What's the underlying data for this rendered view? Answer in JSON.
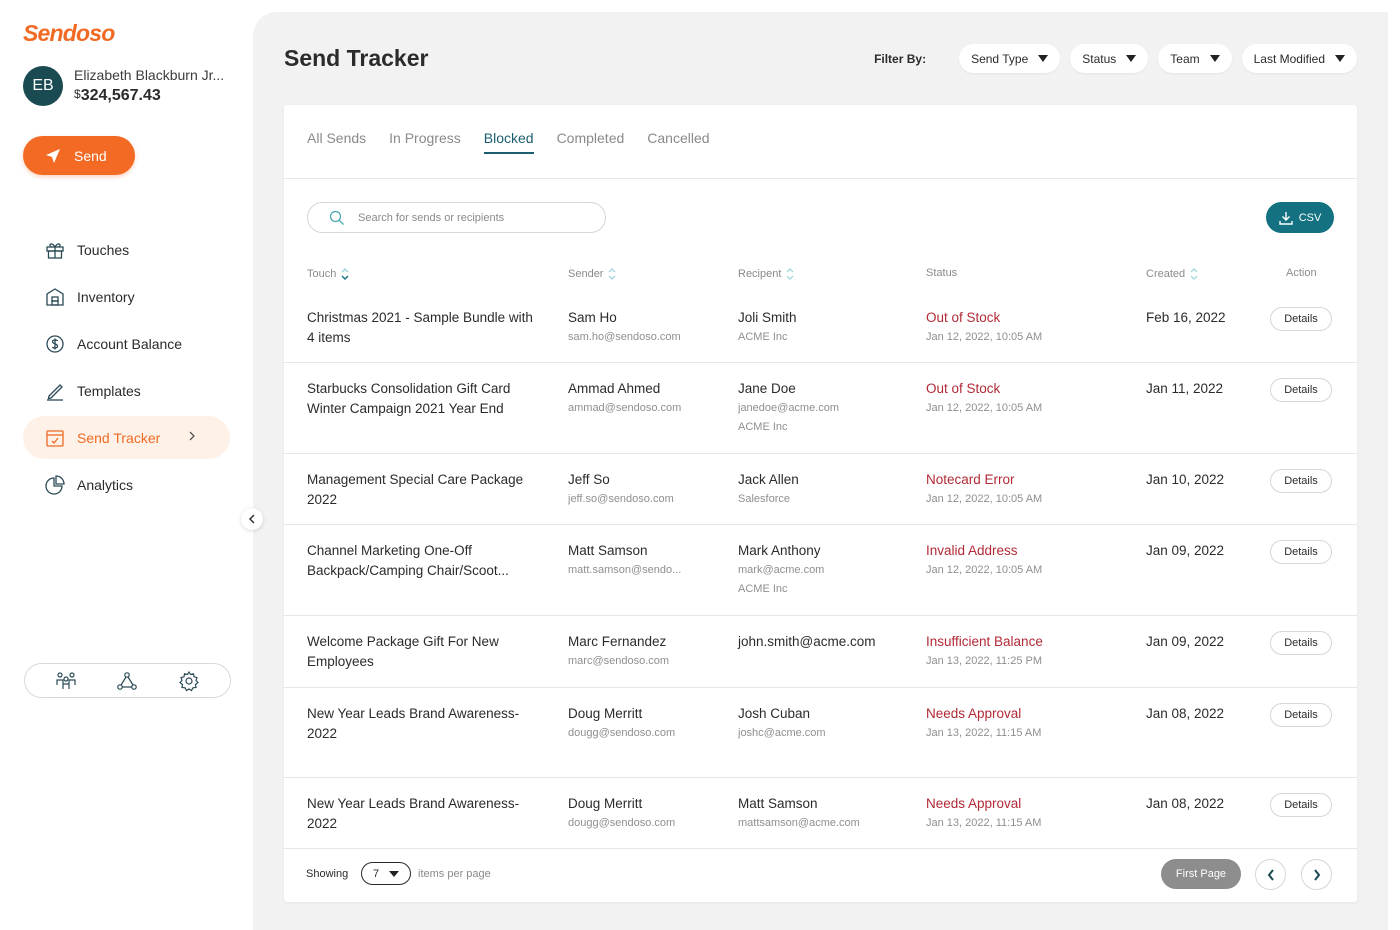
{
  "brand": {
    "logo": "Sendoso",
    "accent": "#f26a23",
    "teal": "#137181",
    "error": "#b12a36"
  },
  "user": {
    "initials": "EB",
    "name": "Elizabeth Blackburn Jr...",
    "currency": "$",
    "balance": "324,567.43"
  },
  "sidebar": {
    "send_label": "Send",
    "items": [
      {
        "label": "Touches",
        "icon": "gift-icon"
      },
      {
        "label": "Inventory",
        "icon": "warehouse-icon"
      },
      {
        "label": "Account Balance",
        "icon": "dollar-icon"
      },
      {
        "label": "Templates",
        "icon": "pen-icon"
      },
      {
        "label": "Send Tracker",
        "icon": "tracker-icon",
        "active": true
      },
      {
        "label": "Analytics",
        "icon": "pie-chart-icon"
      }
    ],
    "bottom_icons": [
      "people-icon",
      "network-icon",
      "gear-icon"
    ]
  },
  "header": {
    "title": "Send Tracker",
    "filter_label": "Filter By:",
    "filters": [
      "Send Type",
      "Status",
      "Team",
      "Last Modified"
    ]
  },
  "tabs": [
    "All Sends",
    "In Progress",
    "Blocked",
    "Completed",
    "Cancelled"
  ],
  "active_tab": "Blocked",
  "search": {
    "placeholder": "Search for sends or recipients"
  },
  "csv_label": "CSV",
  "columns": {
    "touch": "Touch",
    "sender": "Sender",
    "recipient": "Recipent",
    "status": "Status",
    "created": "Created",
    "action": "Action"
  },
  "rows": [
    {
      "touch": "Christmas 2021 - Sample Bundle with 4 items",
      "sender": "Sam Ho",
      "sender_email": "sam.ho@sendoso.com",
      "recipient": "Joli Smith",
      "recipient_lines": [
        "ACME Inc"
      ],
      "status": "Out of Stock",
      "status_time": "Jan 12, 2022, 10:05 AM",
      "created": "Feb 16, 2022",
      "action": "Details"
    },
    {
      "touch": "Starbucks Consolidation Gift Card Winter Campaign 2021 Year End",
      "sender": "Ammad Ahmed",
      "sender_email": "ammad@sendoso.com",
      "recipient": "Jane Doe",
      "recipient_lines": [
        "janedoe@acme.com",
        "ACME Inc"
      ],
      "status": "Out of Stock",
      "status_time": "Jan 12, 2022, 10:05 AM",
      "created": "Jan 11, 2022",
      "action": "Details"
    },
    {
      "touch": "Management Special Care Package 2022",
      "sender": "Jeff So",
      "sender_email": "jeff.so@sendoso.com",
      "recipient": "Jack Allen",
      "recipient_lines": [
        "Salesforce"
      ],
      "status": "Notecard Error",
      "status_time": "Jan 12, 2022, 10:05 AM",
      "created": "Jan 10, 2022",
      "action": "Details"
    },
    {
      "touch": "Channel Marketing One-Off Backpack/Camping Chair/Scoot...",
      "sender": "Matt Samson",
      "sender_email": "matt.samson@sendo...",
      "recipient": "Mark Anthony",
      "recipient_lines": [
        "mark@acme.com",
        "ACME Inc"
      ],
      "status": "Invalid Address",
      "status_time": "Jan 12, 2022, 10:05 AM",
      "created": "Jan 09, 2022",
      "action": "Details"
    },
    {
      "touch": "Welcome Package Gift For New Employees",
      "sender": "Marc Fernandez",
      "sender_email": "marc@sendoso.com",
      "recipient": "john.smith@acme.com",
      "recipient_lines": [],
      "status": "Insufficient Balance",
      "status_time": "Jan 13, 2022, 11:25 PM",
      "created": "Jan 09, 2022",
      "action": "Details"
    },
    {
      "touch": "New Year Leads Brand Awareness-2022",
      "sender": "Doug Merritt",
      "sender_email": "dougg@sendoso.com",
      "recipient": "Josh Cuban",
      "recipient_lines": [
        "joshc@acme.com"
      ],
      "status": "Needs Approval",
      "status_time": "Jan 13, 2022, 11:15 AM",
      "created": "Jan 08, 2022",
      "action": "Details"
    },
    {
      "touch": "New Year Leads Brand Awareness-2022",
      "sender": "Doug Merritt",
      "sender_email": "dougg@sendoso.com",
      "recipient": "Matt Samson",
      "recipient_lines": [
        "mattsamson@acme.com"
      ],
      "status": "Needs Approval",
      "status_time": "Jan 13, 2022, 11:15 AM",
      "created": "Jan 08, 2022",
      "action": "Details"
    }
  ],
  "footer": {
    "showing_label": "Showing",
    "per_page": "7",
    "items_label": "items per page",
    "first_page": "First Page"
  }
}
